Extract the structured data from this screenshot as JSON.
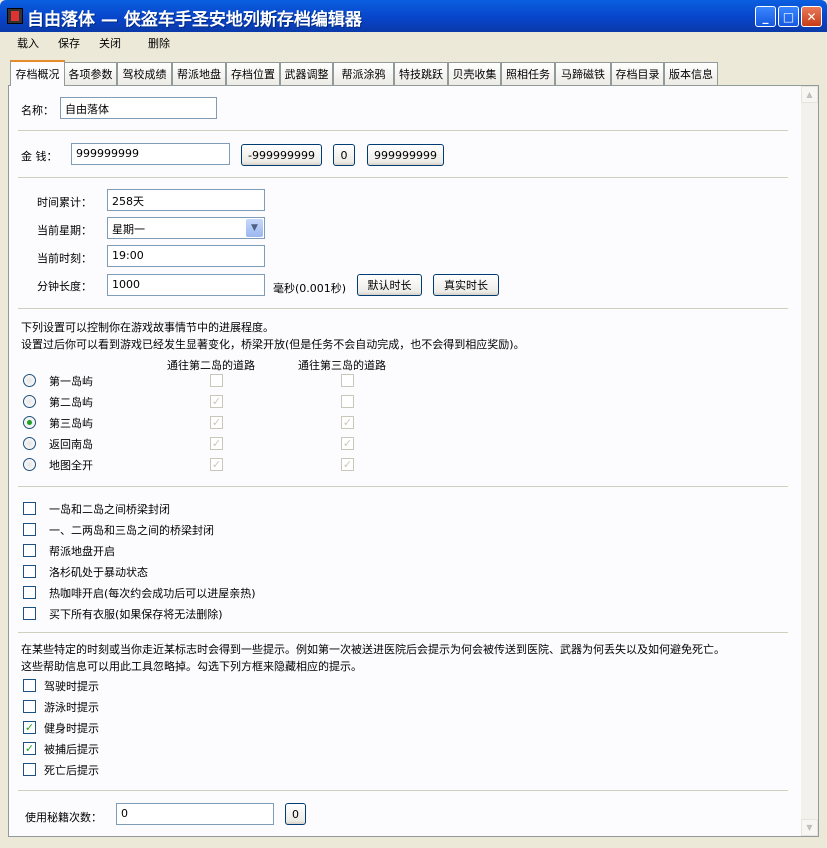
{
  "window": {
    "title": "自由落体 — 侠盗车手圣安地列斯存档编辑器",
    "min": "_",
    "max": "□",
    "close": "✕"
  },
  "menu": [
    "载入",
    "保存",
    "关闭",
    "删除"
  ],
  "tabs": [
    "存档概况",
    "各项参数",
    "驾校成绩",
    "帮派地盘",
    "存档位置",
    "武器调整",
    "帮派涂鸦",
    "特技跳跃",
    "贝壳收集",
    "照相任务",
    "马蹄磁铁",
    "存档目录",
    "版本信息"
  ],
  "name": {
    "label": "名称：",
    "value": "自由落体"
  },
  "money": {
    "label": "金  钱：",
    "value": "999999999",
    "btn_min": "-999999999",
    "btn_zero": "0",
    "btn_max": "999999999"
  },
  "time": {
    "days_label": "时间累计：",
    "days_value": "258天",
    "weekday_label": "当前星期：",
    "weekday_value": "星期一",
    "clock_label": "当前时刻：",
    "clock_value": "19:00",
    "minute_label": "分钟长度：",
    "minute_value": "1000",
    "minute_unit": "毫秒(0.001秒)",
    "default_btn": "默认时长",
    "real_btn": "真实时长"
  },
  "progress": {
    "desc1": "下列设置可以控制你在游戏故事情节中的进展程度。",
    "desc2": "设置过后你可以看到游戏已经发生显著变化，桥梁开放(但是任务不会自动完成，也不会得到相应奖励)。",
    "col1": "通往第二岛的道路",
    "col2": "通往第三岛的道路",
    "rows": [
      {
        "label": "第一岛屿",
        "selected": false,
        "c1": false,
        "c2": false
      },
      {
        "label": "第二岛屿",
        "selected": false,
        "c1": true,
        "c2": false
      },
      {
        "label": "第三岛屿",
        "selected": true,
        "c1": true,
        "c2": true
      },
      {
        "label": "返回南岛",
        "selected": false,
        "c1": true,
        "c2": true
      },
      {
        "label": "地图全开",
        "selected": false,
        "c1": true,
        "c2": true
      }
    ]
  },
  "flags": [
    {
      "label": "一岛和二岛之间桥梁封闭",
      "checked": false
    },
    {
      "label": "一、二两岛和三岛之间的桥梁封闭",
      "checked": false
    },
    {
      "label": "帮派地盘开启",
      "checked": false
    },
    {
      "label": "洛杉矶处于暴动状态",
      "checked": false
    },
    {
      "label": "热咖啡开启(每次约会成功后可以进屋亲热)",
      "checked": false
    },
    {
      "label": "买下所有衣服(如果保存将无法删除)",
      "checked": false
    }
  ],
  "hints": {
    "desc1": "在某些特定的时刻或当你走近某标志时会得到一些提示。例如第一次被送进医院后会提示为何会被传送到医院、武器为何丢失以及如何避免死亡。",
    "desc2": "这些帮助信息可以用此工具忽略掉。勾选下列方框来隐藏相应的提示。",
    "items": [
      {
        "label": "驾驶时提示",
        "checked": false
      },
      {
        "label": "游泳时提示",
        "checked": false
      },
      {
        "label": "健身时提示",
        "checked": true
      },
      {
        "label": "被捕后提示",
        "checked": true
      },
      {
        "label": "死亡后提示",
        "checked": false
      }
    ]
  },
  "cheats": {
    "label": "使用秘籍次数：",
    "value": "0",
    "btn": "0"
  },
  "colors": {
    "accent": "#0a5fe0",
    "check_green": "#21a121",
    "tab_orange": "#e68b2c"
  }
}
